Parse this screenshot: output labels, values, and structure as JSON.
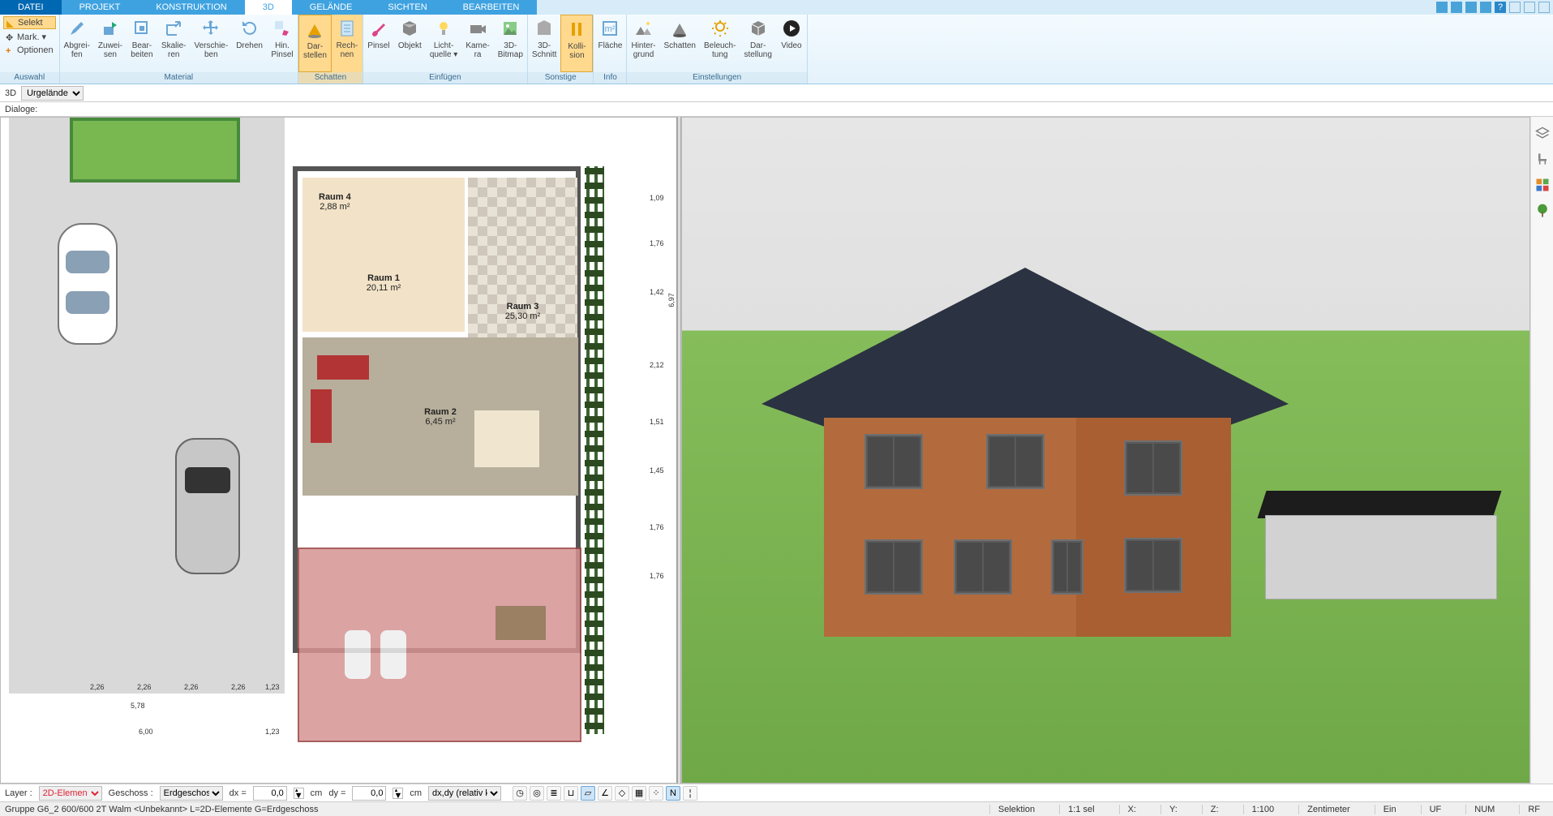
{
  "menu": {
    "tabs": [
      "DATEI",
      "PROJEKT",
      "KONSTRUKTION",
      "3D",
      "GELÄNDE",
      "SICHTEN",
      "BEARBEITEN"
    ],
    "active_index": 3
  },
  "selection_panel": {
    "select": "Selekt",
    "mark": "Mark.",
    "options": "Optionen",
    "group_label": "Auswahl"
  },
  "ribbon": {
    "groups": [
      {
        "label": "Material",
        "buttons": [
          {
            "id": "abgreifen",
            "label": "Abgrei-\nfen"
          },
          {
            "id": "zuweisen",
            "label": "Zuwei-\nsen"
          },
          {
            "id": "bearbeiten",
            "label": "Bear-\nbeiten"
          },
          {
            "id": "skalieren",
            "label": "Skalie-\nren"
          },
          {
            "id": "verschieben",
            "label": "Verschie-\nben"
          },
          {
            "id": "drehen",
            "label": "Drehen"
          },
          {
            "id": "hin-pinsel",
            "label": "Hin.\nPinsel"
          }
        ]
      },
      {
        "label": "Schatten",
        "active": true,
        "buttons": [
          {
            "id": "schatten-darstellen",
            "label": "Dar-\nstellen",
            "active": true
          },
          {
            "id": "rechnen",
            "label": "Rech-\nnen"
          }
        ]
      },
      {
        "label": "Einfügen",
        "buttons": [
          {
            "id": "pinsel",
            "label": "Pinsel"
          },
          {
            "id": "objekt",
            "label": "Objekt"
          },
          {
            "id": "lichtquelle",
            "label": "Licht-\nquelle ▾"
          },
          {
            "id": "kamera",
            "label": "Kame-\nra"
          },
          {
            "id": "bitmap3d",
            "label": "3D-\nBitmap"
          }
        ]
      },
      {
        "label": "Sonstige",
        "buttons": [
          {
            "id": "schnitt3d",
            "label": "3D-\nSchnitt"
          },
          {
            "id": "kollision",
            "label": "Kolli-\nsion",
            "active": true
          }
        ]
      },
      {
        "label": "Info",
        "buttons": [
          {
            "id": "flaeche",
            "label": "Fläche"
          }
        ]
      },
      {
        "label": "Einstellungen",
        "buttons": [
          {
            "id": "hintergrund",
            "label": "Hinter-\ngrund"
          },
          {
            "id": "schatten-einst",
            "label": "Schatten"
          },
          {
            "id": "beleuchtung",
            "label": "Beleuch-\ntung"
          },
          {
            "id": "darstellung",
            "label": "Dar-\nstellung"
          },
          {
            "id": "video",
            "label": "Video"
          }
        ]
      }
    ]
  },
  "subheader": {
    "label_3d": "3D",
    "dropdown_value": "Urgelände"
  },
  "dialoge_label": "Dialoge:",
  "right_tools": [
    "layers-icon",
    "chair-icon",
    "palette-icon",
    "tree-icon"
  ],
  "floorplan": {
    "rooms": [
      {
        "id": "r4",
        "name": "Raum 4",
        "area": "2,88 m²"
      },
      {
        "id": "r1",
        "name": "Raum 1",
        "area": "20,11 m²"
      },
      {
        "id": "r3",
        "name": "Raum 3",
        "area": "25,30 m²"
      },
      {
        "id": "r2",
        "name": "Raum 2",
        "area": "6,45 m²"
      }
    ],
    "dimensions_bottom": [
      "2,26",
      "2,26",
      "2,26",
      "2,26",
      "1,23"
    ],
    "dim_totals": [
      "5,78",
      "6,00",
      "1,23"
    ],
    "dim_right": [
      "1,09",
      "1,76",
      "1,42",
      "2,12",
      "1,51",
      "1,45",
      "1,76",
      "1,76"
    ],
    "dim_right_total": "6,97"
  },
  "bottombar": {
    "layer_label": "Layer :",
    "layer_value": "2D-Elemen",
    "geschoss_label": "Geschoss :",
    "geschoss_value": "Erdgeschos",
    "dx_label": "dx =",
    "dx_value": "0,0",
    "dy_label": "dy =",
    "dy_value": "0,0",
    "unit": "cm",
    "mode_value": "dx,dy (relativ ka",
    "snap_icons": [
      "clock",
      "target",
      "stack",
      "magnet",
      "line",
      "angle",
      "grid",
      "dots",
      "ortho",
      "n",
      "cursor"
    ]
  },
  "statusbar": {
    "left": "Gruppe G6_2 600/600 2T Walm <Unbekannt> L=2D-Elemente G=Erdgeschoss",
    "selection_label": "Selektion",
    "ratio": "1:1 sel",
    "x_label": "X:",
    "y_label": "Y:",
    "z_label": "Z:",
    "scale": "1:100",
    "unit": "Zentimeter",
    "on": "Ein",
    "uf": "UF",
    "num": "NUM",
    "rf": "RF"
  }
}
